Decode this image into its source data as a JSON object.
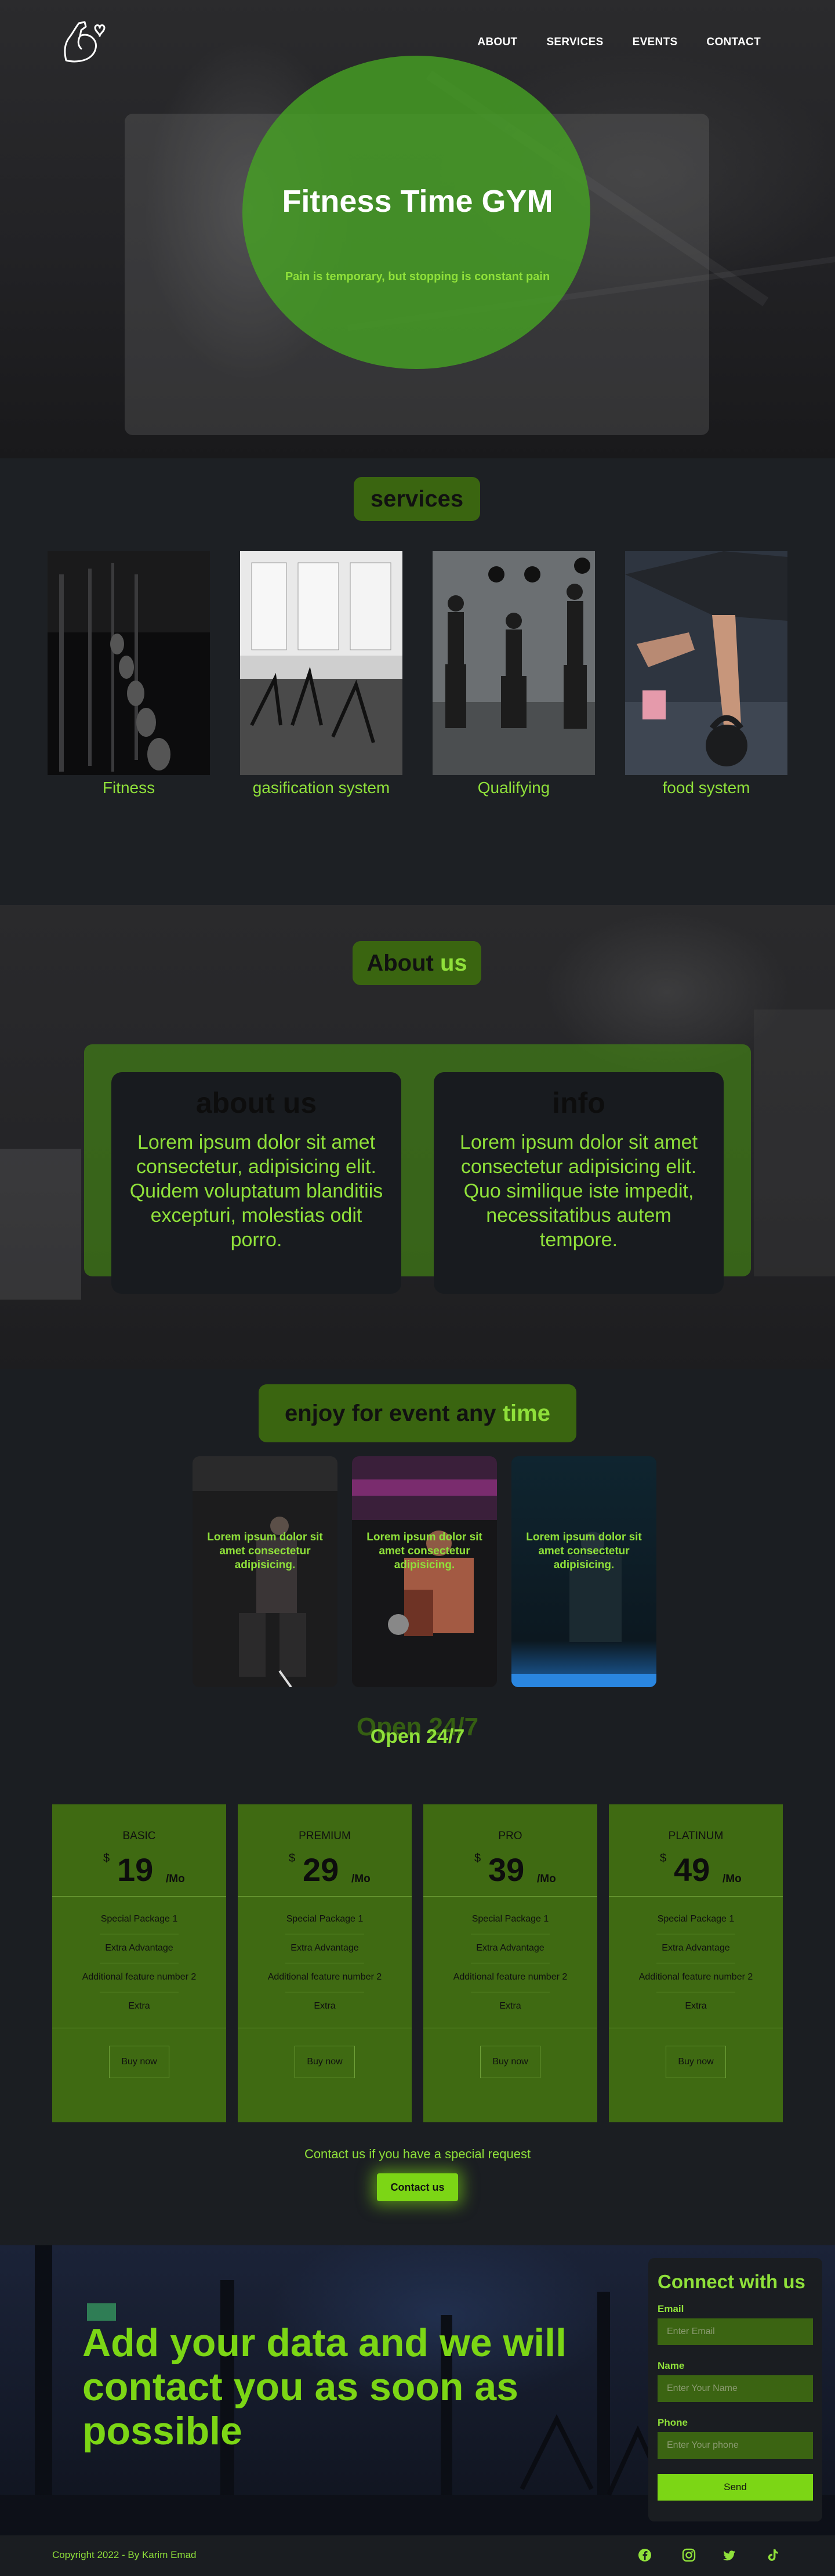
{
  "nav": {
    "items": [
      "ABOUT",
      "SERVICES",
      "EVENTS",
      "CONTACT"
    ]
  },
  "hero": {
    "title": "Fitness Time GYM",
    "subtitle": "Pain is temporary, but stopping is constant pain"
  },
  "services": {
    "heading": "services",
    "cards": [
      {
        "label": "Fitness",
        "icon": "dumbbell-rack-photo"
      },
      {
        "label": "gasification system",
        "icon": "treadmill-room-photo"
      },
      {
        "label": "Qualifying",
        "icon": "group-workout-photo"
      },
      {
        "label": "food system",
        "icon": "kettlebell-photo"
      }
    ]
  },
  "about": {
    "heading_main": "About",
    "heading_highlight": "us",
    "cards": [
      {
        "title": "about us",
        "text": "Lorem ipsum dolor sit amet consectetur, adipisicing elit. Quidem voluptatum blanditiis excepturi, molestias odit porro."
      },
      {
        "title": "info",
        "text": "Lorem ipsum dolor sit amet consectetur adipisicing elit. Quo similique iste impedit, necessitatibus autem tempore."
      }
    ]
  },
  "events": {
    "heading_main": "enjoy for event any",
    "heading_highlight": "time",
    "cards": [
      {
        "text": "Lorem ipsum dolor sit amet consectetur adipisicing."
      },
      {
        "text": "Lorem ipsum dolor sit amet consectetur adipisicing."
      },
      {
        "text": "Lorem ipsum dolor sit amet consectetur adipisicing."
      }
    ],
    "open_shadow": "Open 24/7",
    "open_main": "Open 24/7"
  },
  "pricing": {
    "plans": [
      {
        "name": "BASIC",
        "currency": "$",
        "price": "19",
        "period": "/Mo",
        "features": [
          "Special Package 1",
          "Extra Advantage",
          "Additional feature number 2",
          "Extra"
        ],
        "button": "Buy now"
      },
      {
        "name": "PREMIUM",
        "currency": "$",
        "price": "29",
        "period": "/Mo",
        "features": [
          "Special Package 1",
          "Extra Advantage",
          "Additional feature number 2",
          "Extra"
        ],
        "button": "Buy now"
      },
      {
        "name": "PRO",
        "currency": "$",
        "price": "39",
        "period": "/Mo",
        "features": [
          "Special Package 1",
          "Extra Advantage",
          "Additional feature number 2",
          "Extra"
        ],
        "button": "Buy now"
      },
      {
        "name": "PLATINUM",
        "currency": "$",
        "price": "49",
        "period": "/Mo",
        "features": [
          "Special Package 1",
          "Extra Advantage",
          "Additional feature number 2",
          "Extra"
        ],
        "button": "Buy now"
      }
    ],
    "contact_line": "Contact us if you have a special request",
    "contact_button": "Contact us"
  },
  "cta": {
    "text": "Add your data and we will contact you as soon as possible"
  },
  "form": {
    "title": "Connect with us",
    "email_label": "Email",
    "email_placeholder": "Enter Email",
    "name_label": "Name",
    "name_placeholder": "Enter Your Name",
    "phone_label": "Phone",
    "phone_placeholder": "Enter Your phone",
    "send": "Send"
  },
  "footer": {
    "copyright": "Copyright 2022 - By Karim Emad",
    "social": [
      "facebook-icon",
      "instagram-icon",
      "twitter-icon",
      "tiktok-icon"
    ]
  },
  "colors": {
    "accent": "#8fe03a",
    "accent_bright": "#7cd615",
    "dark_green": "#3f6a12",
    "background": "#1a1d21"
  }
}
